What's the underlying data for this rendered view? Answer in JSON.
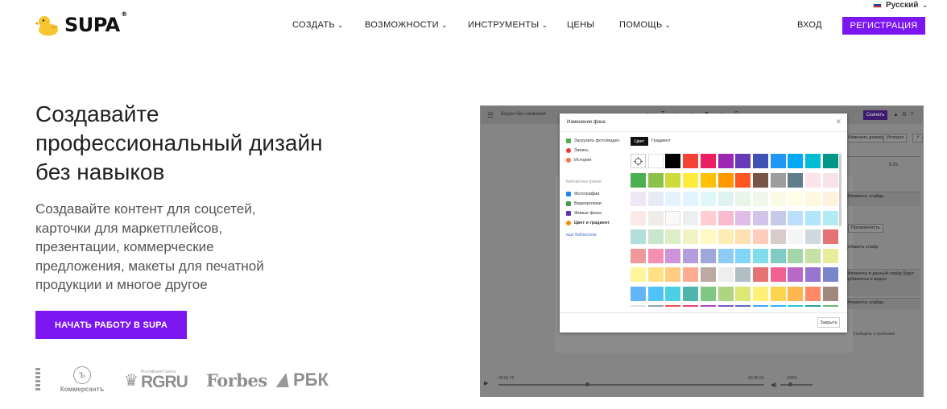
{
  "header": {
    "language": "Русский",
    "brand": "SUPA",
    "brand_mark": "®",
    "nav": [
      {
        "label": "СОЗДАТЬ",
        "has_dropdown": true
      },
      {
        "label": "ВОЗМОЖНОСТИ",
        "has_dropdown": true
      },
      {
        "label": "ИНСТРУМЕНТЫ",
        "has_dropdown": true
      },
      {
        "label": "ЦЕНЫ",
        "has_dropdown": false
      },
      {
        "label": "ПОМОЩЬ",
        "has_dropdown": true
      }
    ],
    "login_label": "ВХОД",
    "register_label": "РЕГИСТРАЦИЯ",
    "accent_color": "#7b16f0"
  },
  "hero": {
    "title": "Создавайте профессиональный дизайн без навыков",
    "subtitle": "Создавайте контент для соцсетей, карточки для маркетплейсов, презентации, коммерческие предложения, макеты для печатной продукции и многое другое",
    "cta_label": "НАЧАТЬ РАБОТУ В SUPA"
  },
  "partners": [
    "Коммерсантъ",
    "RGRU",
    "Forbes",
    "РБК"
  ],
  "partner_rgru_caption": "Российская Газета",
  "editor": {
    "project_title": "Видео без названия",
    "download_label": "Скачать",
    "side": {
      "resize_label": "Изменить размер",
      "history_label": "История",
      "duration": "5.0s",
      "slide_elements": "Элементы слайда",
      "transparency_label": "Прозрачность",
      "add_slide": "Добавить слайд",
      "hint": "Элементы в данный слайд будут добавлены в видео.",
      "support_label": "Сообщить о проблеме"
    },
    "time_start": "00:01.70",
    "time_end": "00:00.00",
    "zoom": "100%"
  },
  "modal": {
    "title": "Изменение фона",
    "close_icon": "close-icon",
    "menu": [
      {
        "label": "Загрузить фото/видео",
        "icon": "upload-icon",
        "color": "#4caf50"
      },
      {
        "label": "Запись",
        "icon": "record-icon",
        "color": "#e53935"
      },
      {
        "label": "История",
        "icon": "history-icon",
        "color": "#ff7043"
      }
    ],
    "library_title": "Библиотека фонов",
    "library": [
      {
        "label": "Фотографии",
        "icon": "photo-icon",
        "color": "#1e88e5"
      },
      {
        "label": "Видеоролики",
        "icon": "video-icon",
        "color": "#43a047"
      },
      {
        "label": "Живые фоны",
        "icon": "live-bg-icon",
        "color": "#5e35b1"
      },
      {
        "label": "Цвет и градиент",
        "icon": "palette-icon",
        "color": "#fb8c00"
      }
    ],
    "more_libraries": "еще библиотеки",
    "tab_color": "Цвет",
    "tab_gradient": "Градиент",
    "close_button": "Закрыть",
    "swatches": [
      [
        "picker",
        "#ffffff",
        "#000000",
        "#f44336",
        "#e91e63",
        "#9c27b0",
        "#673ab7",
        "#3f51b5",
        "#2196f3",
        "#03a9f4",
        "#00bcd4",
        "#009688"
      ],
      [
        "#4caf50",
        "#8bc34a",
        "#cddc39",
        "#ffeb3b",
        "#ffc107",
        "#ff9800",
        "#ff5722",
        "#795548",
        "#9e9e9e",
        "#607d8b",
        "#fce4ec",
        "#f8e1e7"
      ],
      [
        "#ede7f6",
        "#e8eaf6",
        "#e3f2fd",
        "#e1f5fe",
        "#e0f7fa",
        "#e0f2f1",
        "#e8f5e9",
        "#f1f8e9",
        "#f9fbe7",
        "#fffde7",
        "#fff8e1",
        "#fff3e0"
      ],
      [
        "#fbe9e7",
        "#efebe9",
        "#fafafa",
        "#eceff1",
        "#ffcdd2",
        "#f8bbd0",
        "#e1bee7",
        "#d1c4e9",
        "#c5cae9",
        "#bbdefb",
        "#b3e5fc",
        "#b2ebf2"
      ],
      [
        "#b2dfdb",
        "#c8e6c9",
        "#dcedc8",
        "#f0f4c3",
        "#fff9c4",
        "#ffecb3",
        "#ffe0b2",
        "#ffccbc",
        "#d7ccc8",
        "#f5f5f5",
        "#cfd8dc",
        "#e57373"
      ],
      [
        "#ef9a9a",
        "#f48fb1",
        "#ce93d8",
        "#b39ddb",
        "#9fa8da",
        "#90caf9",
        "#81d4fa",
        "#80deea",
        "#80cbc4",
        "#a5d6a7",
        "#c5e1a5",
        "#e6ee9c"
      ],
      [
        "#fff59d",
        "#ffe082",
        "#ffcc80",
        "#ffab91",
        "#bcaaa4",
        "#eeeeee",
        "#b0bec5",
        "#e57373",
        "#f06292",
        "#ba68c8",
        "#9575cd",
        "#7986cb"
      ],
      [
        "#64b5f6",
        "#4fc3f7",
        "#4dd0e1",
        "#4db6ac",
        "#81c784",
        "#aed581",
        "#dce775",
        "#fff176",
        "#ffd54f",
        "#ffb74d",
        "#ff8a65",
        "#a1887f"
      ],
      [
        "#e0e0e0",
        "#90a4ae",
        "#ef5350",
        "#ec407a",
        "#ab47bc",
        "#7e57c2",
        "#5c6bc0",
        "#42a5f5",
        "#29b6f6",
        "#26c6da",
        "#26a69a",
        "#66bb6a"
      ]
    ]
  }
}
